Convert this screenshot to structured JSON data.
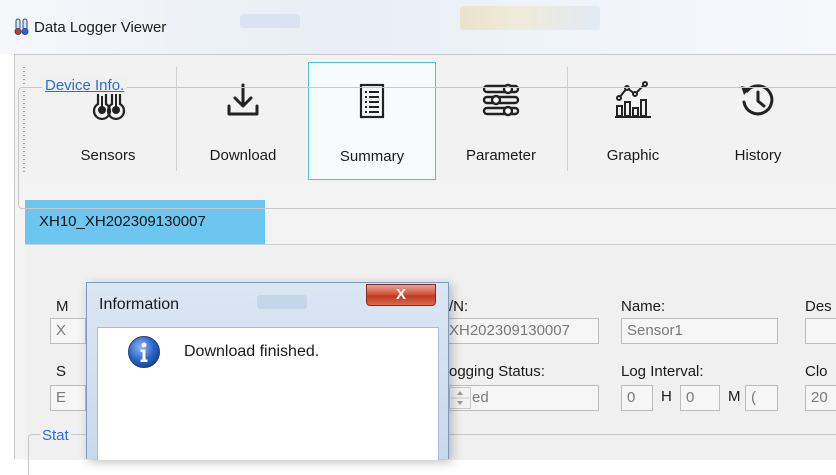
{
  "window": {
    "title": "Data Logger Viewer",
    "icon": "thermometer-app-icon"
  },
  "toolbar": {
    "buttons": [
      {
        "label": "Sensors",
        "icon": "thermometer-icon"
      },
      {
        "label": "Download",
        "icon": "download-icon"
      },
      {
        "label": "Summary",
        "icon": "list-document-icon",
        "active": true
      },
      {
        "label": "Parameter",
        "icon": "sliders-icon"
      },
      {
        "label": "Graphic",
        "icon": "chart-icon"
      },
      {
        "label": "History",
        "icon": "history-icon"
      }
    ]
  },
  "tab": {
    "label": "XH10_XH202309130007"
  },
  "device_info": {
    "title": "Device Info.",
    "labels": {
      "model": "M",
      "sn": "/N:",
      "name": "Name:",
      "desc": "Des",
      "status": "S",
      "logging_status": "ogging Status:",
      "log_interval": "Log Interval:",
      "clock": "Clo"
    },
    "values": {
      "model": "X",
      "sn": "XH202309130007",
      "name": "Sensor1",
      "desc": "",
      "status": "E",
      "logging_status": "ed",
      "interval_h": "0",
      "interval_h_unit": "H",
      "interval_m": "0",
      "interval_m_unit": "M",
      "interval_s": "(",
      "clock": "20"
    }
  },
  "status_group": {
    "title": "Stat"
  },
  "dialog": {
    "title": "Information",
    "close_label": "X",
    "message": "Download finished.",
    "icon": "info-icon"
  },
  "colors": {
    "accent": "#50c6c8",
    "tab": "#6cc6f0",
    "link": "#2a6fd1",
    "close": "#c9452d"
  }
}
